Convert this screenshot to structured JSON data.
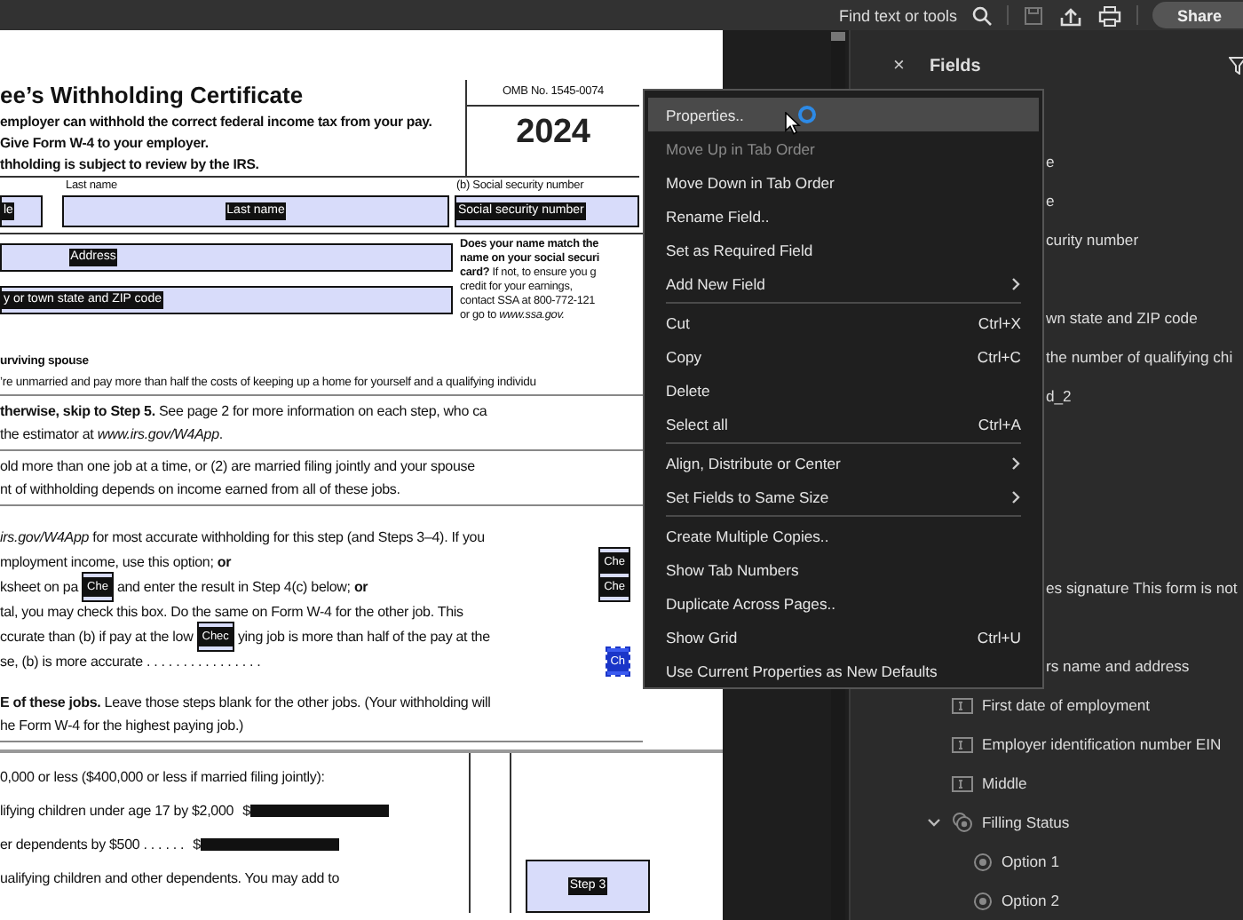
{
  "toolbar": {
    "search_label": "Find text or tools",
    "share_button": "Share"
  },
  "doc": {
    "title": "ee’s Withholding Certificate",
    "omb": "OMB No. 1545-0074",
    "year": "2024",
    "intro": [
      "employer can withhold the correct federal income tax from your pay.",
      "Give Form W-4 to your employer.",
      "thholding is subject to review by the IRS."
    ],
    "name_labels": [
      "Last name",
      "(b)  Social security number"
    ],
    "name_fields": [
      "le",
      "Last name",
      "Social security number"
    ],
    "address_fields": [
      "Address",
      "y or town state and ZIP code"
    ],
    "ssa_note": [
      "**Does your name match the**",
      "**name on your social securi**",
      "**card?** If not, to ensure you g",
      "credit for your earnings,",
      "contact SSA at 800-772-121",
      "or go to *www.ssa.gov.*"
    ],
    "filing": [
      "**urviving spouse**",
      "’re unmarried and pay more than half the costs of keeping up a home for yourself and a qualifying individu"
    ],
    "step_intro": [
      "**therwise, skip to Step 5.** See page 2 for more information on each step, who ca",
      "the estimator at *www.irs.gov/W4App*."
    ],
    "step2": [
      "old more than one job at a time, or (2) are married filing jointly and your spouse",
      "nt of withholding depends on income earned from all of these jobs."
    ],
    "options": [
      [
        {
          "kind": "text",
          "text": "*irs.gov/W4App* for most accurate withholding for this step (and Steps 3–4). If you"
        }
      ],
      [
        {
          "kind": "text",
          "text": "mployment income, use this option; **or**"
        },
        {
          "kind": "checkbox",
          "label": "Che",
          "selected": false
        }
      ],
      [
        {
          "kind": "text",
          "text": "ksheet on pa"
        },
        {
          "kind": "checkbox",
          "label": "Che",
          "selected": false
        },
        {
          "kind": "text",
          "text": "and enter the result in Step 4(c) below; **or**"
        },
        {
          "kind": "checkbox",
          "label": "Che",
          "selected": false
        }
      ],
      [
        {
          "kind": "text",
          "text": "tal, you may check this box. Do the same on Form W-4 for the other job. This"
        }
      ],
      [
        {
          "kind": "text",
          "text": "ccurate than (b) if pay at the low"
        },
        {
          "kind": "checkbox",
          "label": "Chec",
          "selected": false
        },
        {
          "kind": "text",
          "text": "ying job is more than half of the pay at the"
        }
      ],
      [
        {
          "kind": "text",
          "text": "se, (b) is more accurate  .  .  .  .  .  .  .  .  .  .  .  .  .  .  .  ."
        },
        {
          "kind": "checkbox",
          "label": "Ch",
          "selected": true
        }
      ]
    ],
    "step_note": [
      "**E of these jobs.** Leave those steps blank for the other jobs. (Your withholding will",
      "he Form W-4 for the highest paying job.)"
    ],
    "step3": [
      {
        "kind": "text",
        "text": "0,000 or less ($400,000 or less if married filing jointly):"
      },
      {
        "kind": "amount",
        "text": "lifying children under age 17 by $2,000",
        "currency": "$"
      },
      {
        "kind": "amount",
        "text": "er dependents by $500  .  .  .  .  .  .",
        "currency": "$"
      },
      {
        "kind": "text",
        "text": "ualifying children and other dependents. You may add to"
      }
    ],
    "step3_field": "Step 3"
  },
  "panel": {
    "close": "×",
    "title": "Fields",
    "clipped_groups": [
      [
        "e",
        "e",
        "curity number"
      ],
      [
        "wn state and ZIP code",
        "the number of qualifying chi",
        "d_2"
      ],
      [
        "es signature This form is not"
      ],
      [
        "rs name and address"
      ]
    ],
    "items": [
      {
        "kind": "text_field",
        "label": "First date of employment"
      },
      {
        "kind": "text_field",
        "label": "Employer identification number EIN"
      },
      {
        "kind": "text_field",
        "label": "Middle"
      },
      {
        "kind": "radio_group",
        "label": "Filling Status",
        "expanded": true,
        "children": [
          {
            "kind": "radio",
            "label": "Option 1"
          },
          {
            "kind": "radio",
            "label": "Option 2"
          }
        ]
      }
    ]
  },
  "menu": {
    "groups": [
      [
        {
          "label": "Properties..",
          "selected": true,
          "disabled": false,
          "submenu": false
        },
        {
          "label": "Move Up in Tab Order",
          "selected": false,
          "disabled": true,
          "submenu": false
        },
        {
          "label": "Move Down in Tab Order",
          "selected": false,
          "disabled": false,
          "submenu": false
        },
        {
          "label": "Rename Field..",
          "selected": false,
          "disabled": false,
          "submenu": false
        },
        {
          "label": "Set as Required Field",
          "selected": false,
          "disabled": false,
          "submenu": false
        },
        {
          "label": "Add New Field",
          "selected": false,
          "disabled": false,
          "submenu": true
        }
      ],
      [
        {
          "label": "Cut",
          "shortcut": "Ctrl+X",
          "selected": false,
          "disabled": false,
          "submenu": false
        },
        {
          "label": "Copy",
          "shortcut": "Ctrl+C",
          "selected": false,
          "disabled": false,
          "submenu": false
        },
        {
          "label": "Delete",
          "selected": false,
          "disabled": false,
          "submenu": false
        },
        {
          "label": "Select all",
          "shortcut": "Ctrl+A",
          "selected": false,
          "disabled": false,
          "submenu": false
        }
      ],
      [
        {
          "label": "Align, Distribute or Center",
          "selected": false,
          "disabled": false,
          "submenu": true
        },
        {
          "label": "Set Fields to Same Size",
          "selected": false,
          "disabled": false,
          "submenu": true
        }
      ],
      [
        {
          "label": "Create Multiple Copies..",
          "selected": false,
          "disabled": false,
          "submenu": false
        },
        {
          "label": "Show Tab Numbers",
          "selected": false,
          "disabled": false,
          "submenu": false
        },
        {
          "label": "Duplicate Across Pages..",
          "selected": false,
          "disabled": false,
          "submenu": false
        },
        {
          "label": "Show Grid",
          "shortcut": "Ctrl+U",
          "selected": false,
          "disabled": false,
          "submenu": false
        },
        {
          "label": "Use Current Properties as New Defaults",
          "selected": false,
          "disabled": false,
          "submenu": false
        }
      ]
    ]
  }
}
